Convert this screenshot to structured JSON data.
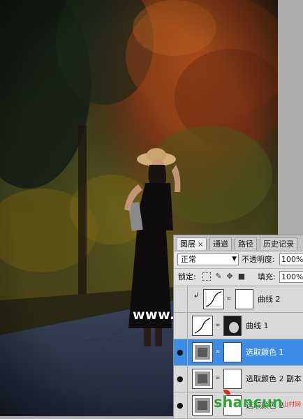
{
  "watermark": "www.68ps.com",
  "logo": {
    "text": "shancun",
    "sub": "山村网"
  },
  "layers_panel": {
    "tabs": [
      {
        "label": "图层",
        "close": "×",
        "active": true
      },
      {
        "label": "通道",
        "active": false
      },
      {
        "label": "路径",
        "active": false
      },
      {
        "label": "历史记录",
        "active": false
      }
    ],
    "blend_mode": "正常",
    "opacity_label": "不透明度:",
    "opacity_value": "100%",
    "lock_label": "锁定:",
    "fill_label": "填充:",
    "fill_value": "100%",
    "layers": [
      {
        "name": "曲线 2",
        "visible": false,
        "clipped": true,
        "selected": false,
        "mask": "white"
      },
      {
        "name": "曲线 1",
        "visible": false,
        "clipped": false,
        "selected": false,
        "mask": "dark"
      },
      {
        "name": "选取颜色 1",
        "visible": true,
        "clipped": false,
        "selected": true,
        "mask": "white"
      },
      {
        "name": "选取颜色 2 副本",
        "visible": true,
        "clipped": false,
        "selected": false,
        "mask": "white"
      },
      {
        "name": "选取颜色 2",
        "visible": true,
        "clipped": false,
        "selected": false,
        "mask": "white"
      }
    ]
  },
  "colors": {
    "selection": "#3c8de6",
    "panel_bg": "#d6d6d6",
    "canvas_bg": "#adadad"
  }
}
